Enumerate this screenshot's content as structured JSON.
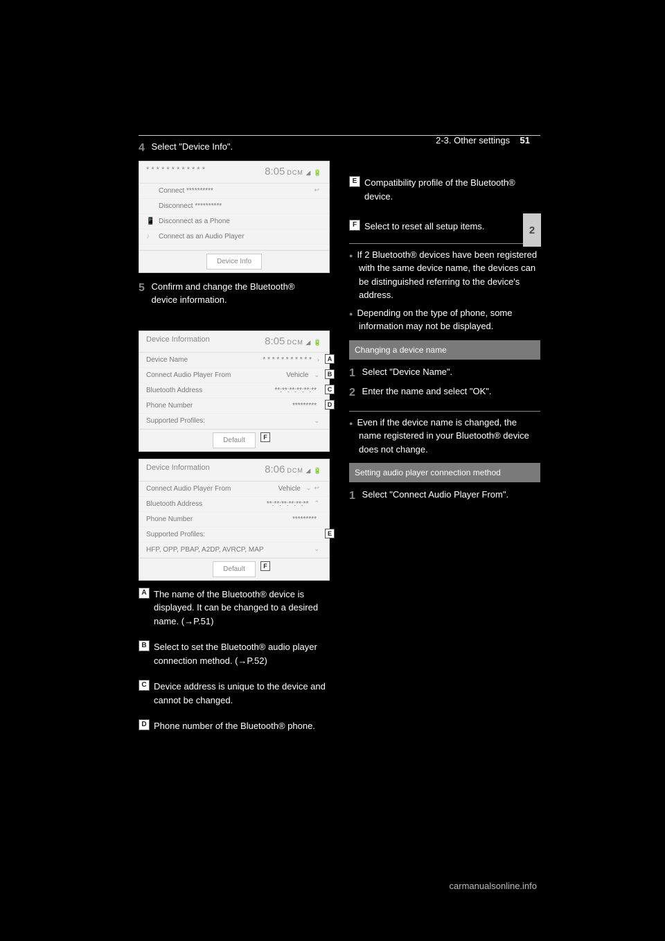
{
  "page_header": "2-3. Other settings",
  "page_number": "51",
  "chapter_tab": "2",
  "left": {
    "step4_num": "4",
    "step4_text": "Select \"Device Info\".",
    "step5_num": "5",
    "step5_text": "Confirm and change the Bluetooth® device information.",
    "shot1": {
      "title": "* * * * * * * * * * * *",
      "time": "8:05",
      "icons": "DCM ◢ 🔋",
      "r1": "Connect **********",
      "r2": "Disconnect **********",
      "r3": "Disconnect as a Phone",
      "r4": "Connect as an Audio Player",
      "footer_btn": "Device Info"
    },
    "shot2": {
      "title": "Device Information",
      "time": "8:05",
      "icons": "DCM ◢ 🔋",
      "r1l": "Device Name",
      "r1m": "* * * * * * * * * * *",
      "r2l": "Connect Audio Player From",
      "r2m": "Vehicle",
      "r3l": "Bluetooth Address",
      "r3m": "**:**:**:**:**:**",
      "r4l": "Phone Number",
      "r4m": "*********",
      "r5l": "Supported Profiles:",
      "footer_btn": "Default"
    },
    "shot3": {
      "title": "Device Information",
      "time": "8:06",
      "icons": "DCM ◢ 🔋",
      "r1l": "Connect Audio Player From",
      "r1m": "Vehicle",
      "r2l": "Bluetooth Address",
      "r2m": "**:**:**:**:**:**",
      "r3l": "Phone Number",
      "r3m": "*********",
      "r4l": "Supported Profiles:",
      "r5l": "HFP,        OPP, PBAP, A2DP, AVRCP, MAP",
      "footer_btn": "Default"
    },
    "a": "The name of the Bluetooth® device is displayed. It can be changed to a desired name. (→P.51)",
    "b": "Select to set the Bluetooth® audio player connection method. (→P.52)",
    "c": "Device address is unique to the device and cannot be changed.",
    "d": "Phone number of the Bluetooth® phone."
  },
  "right": {
    "e": "Compatibility profile of the Bluetooth® device.",
    "f": "Select to reset all setup items.",
    "bullet1": "If 2 Bluetooth® devices have been registered with the same device name, the devices can be distinguished referring to the device's address.",
    "bullet2": "Depending on the type of phone, some information may not be displayed.",
    "sub1_title": "Changing a device name",
    "sub1_step1_num": "1",
    "sub1_step1": "Select \"Device Name\".",
    "sub1_step2_num": "2",
    "sub1_step2": "Enter the name and select \"OK\".",
    "sub1_bullet": "Even if the device name is changed, the name registered in your Bluetooth® device does not change.",
    "sub2_title": "Setting audio player connection method",
    "sub2_step1_num": "1",
    "sub2_step1": "Select \"Connect Audio Player From\"."
  },
  "footer_url": "carmanualsonline.info"
}
